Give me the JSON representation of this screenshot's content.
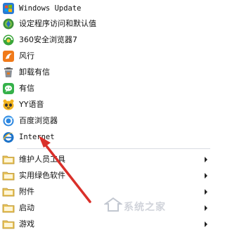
{
  "menu": {
    "items": [
      {
        "label": "Windows Update",
        "icon": "windows-update-icon"
      },
      {
        "label": "设定程序访问和默认值",
        "icon": "default-programs-icon"
      },
      {
        "label": "360安全浏览器7",
        "icon": "360-browser-icon"
      },
      {
        "label": "风行",
        "icon": "funshion-icon"
      },
      {
        "label": "卸载有信",
        "icon": "uninstall-icon"
      },
      {
        "label": "有信",
        "icon": "youxin-icon"
      },
      {
        "label": "YY语音",
        "icon": "yy-voice-icon"
      },
      {
        "label": "百度浏览器",
        "icon": "baidu-browser-icon"
      },
      {
        "label": "Internet",
        "icon": "internet-explorer-icon"
      }
    ],
    "folders": [
      {
        "label": "维护人员工具",
        "icon": "folder-icon"
      },
      {
        "label": "实用绿色软件",
        "icon": "folder-icon"
      },
      {
        "label": "附件",
        "icon": "folder-icon"
      },
      {
        "label": "启动",
        "icon": "folder-icon"
      },
      {
        "label": "游戏",
        "icon": "folder-icon"
      }
    ]
  },
  "watermark": {
    "text": "系统之家"
  },
  "colors": {
    "arrow": "#d9302a",
    "folder": "#e8c35a",
    "accent": "#1d73c9"
  }
}
